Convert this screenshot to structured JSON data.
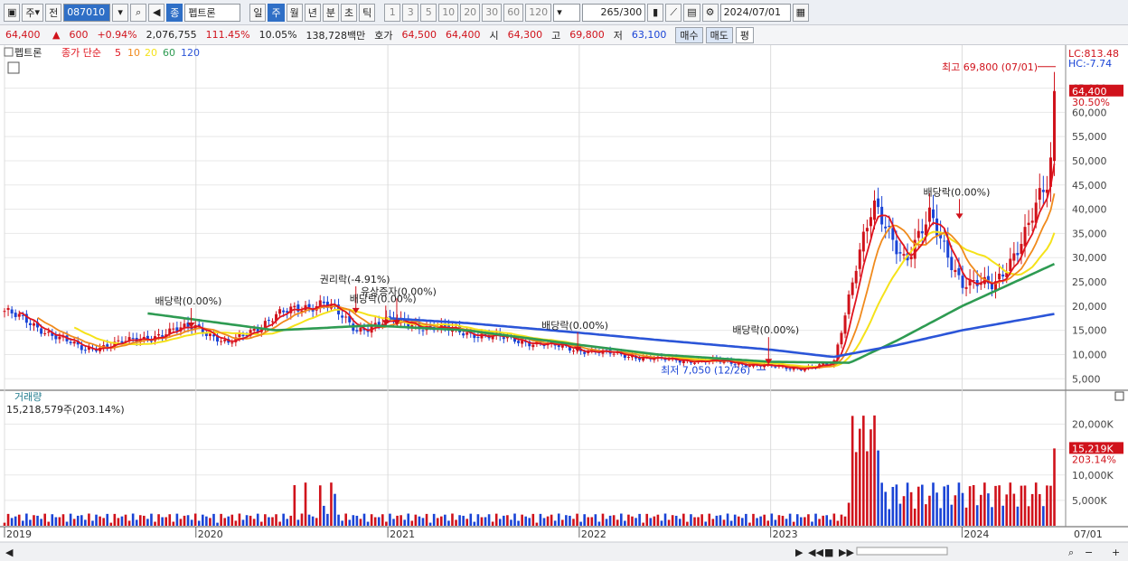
{
  "toolbar": {
    "market": "주",
    "scope": "전",
    "code": "087010",
    "name_tag": "종",
    "name": "펩트론",
    "periods": [
      "일",
      "주",
      "월",
      "년",
      "분",
      "초",
      "틱"
    ],
    "active_period": "주",
    "intervals": [
      "1",
      "3",
      "5",
      "10",
      "20",
      "30",
      "60",
      "120"
    ],
    "count": "265",
    "count_max": "/300",
    "date": "2024/07/01"
  },
  "quote": {
    "price": "64,400",
    "change": "600",
    "change_pct": "+0.94%",
    "volume": "2,076,755",
    "vol_ratio": "111.45%",
    "turnover": "10.05%",
    "amount": "138,728백만",
    "bid_label": "호가",
    "bid": "64,500",
    "ask": "64,400",
    "open_label": "시",
    "open": "64,300",
    "high_label": "고",
    "high": "69,800",
    "low_label": "저",
    "low": "63,100",
    "buy_btn": "매수",
    "sell_btn": "매도",
    "eval_btn": "평"
  },
  "legend": {
    "stock": "펩트론",
    "ma_label": "종가 단순",
    "ma": [
      "5",
      "10",
      "20",
      "60",
      "120"
    ]
  },
  "readouts": {
    "lc": "LC:813.48",
    "hc": "HC:-7.74",
    "price_tag": "64,400",
    "price_pct": "30.50%",
    "vol_tag": "15,219K",
    "vol_pct": "203.14%",
    "volume_title": "거래량",
    "volume_value": "15,218,579주(203.14%)",
    "last_date": "07/01"
  },
  "colors": {
    "up": "#d0121b",
    "down": "#1a44d6",
    "ma5": "#e0141e",
    "ma10": "#f08a1c",
    "ma20": "#f5e21a",
    "ma60": "#2e9b52",
    "ma120": "#2b55d8"
  },
  "chart_data": {
    "type": "candlestick",
    "period": "weekly",
    "x_range": [
      "2019-01",
      "2024-07-01"
    ],
    "year_labels": [
      "2019",
      "2020",
      "2021",
      "2022",
      "2023",
      "2024"
    ],
    "price_axis": {
      "ticks": [
        5000,
        10000,
        15000,
        20000,
        25000,
        30000,
        35000,
        40000,
        45000,
        50000,
        55000,
        60000,
        65000
      ],
      "tick_labels": [
        "5,000",
        "10,000",
        "15,000",
        "20,000",
        "25,000",
        "30,000",
        "35,000",
        "40,000",
        "45,000",
        "50,000",
        "55,000",
        "60,000",
        "65,000"
      ],
      "range": [
        3000,
        72000
      ]
    },
    "volume_axis": {
      "ticks": [
        5000,
        10000,
        15000,
        20000
      ],
      "tick_labels": [
        "5,000K",
        "10,000K",
        "15,000K",
        "20,000K"
      ],
      "range": [
        0,
        24000
      ]
    },
    "close_keypoints": [
      [
        "2019-01-01",
        19000
      ],
      [
        "2019-06-01",
        11000
      ],
      [
        "2019-10-01",
        13500
      ],
      [
        "2020-01-01",
        16000
      ],
      [
        "2020-03-01",
        12000
      ],
      [
        "2020-06-01",
        18000
      ],
      [
        "2020-09-01",
        21000
      ],
      [
        "2020-11-01",
        15000
      ],
      [
        "2021-01-01",
        17000
      ],
      [
        "2021-06-01",
        14500
      ],
      [
        "2022-01-01",
        11000
      ],
      [
        "2022-06-01",
        9000
      ],
      [
        "2022-10-01",
        8500
      ],
      [
        "2023-01-01",
        7500
      ],
      [
        "2023-03-01",
        7200
      ],
      [
        "2023-05-01",
        8000
      ],
      [
        "2023-06-15",
        30000
      ],
      [
        "2023-07-15",
        40000
      ],
      [
        "2023-09-15",
        30000
      ],
      [
        "2023-11-01",
        38000
      ],
      [
        "2024-01-01",
        25000
      ],
      [
        "2024-03-01",
        24000
      ],
      [
        "2024-05-01",
        35000
      ],
      [
        "2024-06-15",
        46000
      ],
      [
        "2024-07-01",
        64400
      ]
    ],
    "ma60_keypoints": [
      [
        "2019-10-01",
        18500
      ],
      [
        "2020-06-01",
        15000
      ],
      [
        "2020-12-01",
        16000
      ],
      [
        "2021-06-01",
        15000
      ],
      [
        "2022-01-01",
        12000
      ],
      [
        "2022-06-01",
        10000
      ],
      [
        "2023-01-01",
        8500
      ],
      [
        "2023-06-01",
        8300
      ],
      [
        "2023-09-01",
        13000
      ],
      [
        "2024-01-01",
        20000
      ],
      [
        "2024-07-01",
        29000
      ]
    ],
    "ma120_keypoints": [
      [
        "2021-01-01",
        17500
      ],
      [
        "2021-06-01",
        16500
      ],
      [
        "2022-01-01",
        14500
      ],
      [
        "2022-06-01",
        13000
      ],
      [
        "2023-01-01",
        11000
      ],
      [
        "2023-05-01",
        9500
      ],
      [
        "2023-09-01",
        12000
      ],
      [
        "2024-01-01",
        15000
      ],
      [
        "2024-07-01",
        18500
      ]
    ],
    "high_marker": {
      "label": "최고 69,800 (07/01)",
      "date": "2024-07-01",
      "value": 69800
    },
    "low_marker": {
      "label": "최저 7,050 (12/26)",
      "date": "2022-12-26",
      "value": 7050
    },
    "events": [
      {
        "label": "배당락(0.00%)",
        "date": "2019-12-23",
        "value": 15500
      },
      {
        "label": "권리락(-4.91%)",
        "date": "2020-11-01",
        "value": 18500
      },
      {
        "label": "배당락(0.00%)",
        "date": "2020-12-28",
        "value": 16000
      },
      {
        "label": "유상증자(0.00%)",
        "date": "2021-01-18",
        "value": 16000
      },
      {
        "label": "배당락(0.00%)",
        "date": "2021-12-29",
        "value": 10500
      },
      {
        "label": "배당락(0.00%)",
        "date": "2022-12-28",
        "value": 8000
      },
      {
        "label": "배당락(0.00%)",
        "date": "2023-12-27",
        "value": 38000
      }
    ]
  }
}
